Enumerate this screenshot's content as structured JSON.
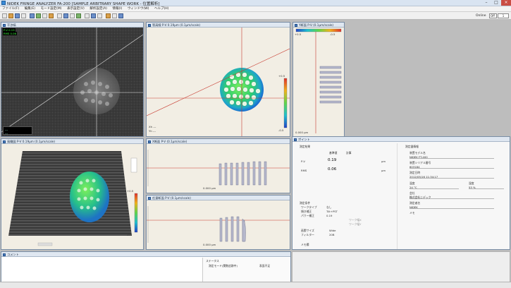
{
  "window": {
    "title": "NIDEK FRINGE ANALYZER FA-200  [SAMPLE ARBITRARY SHAPE WORK - 位置解析]"
  },
  "menu": {
    "items": [
      "ファイル(F)",
      "編集(E)",
      "モード設定(M)",
      "表示設定(V)",
      "解析設定(A)",
      "情報(I)",
      "ウィンドウ(W)",
      "ヘルプ(H)"
    ]
  },
  "toolbar": {
    "display_label": "Online",
    "display_select": "Off",
    "display_num": "1"
  },
  "panels": {
    "p1": {
      "title": "干渉縞",
      "badge_a": "P-V 0.19",
      "badge_b": "RMS 0.06",
      "legend_a": "---",
      "legend_b": "---"
    },
    "p2": {
      "title": "等高線 P-V 0.19µm (0.1µm/scale)",
      "scale_top": "+0.5",
      "scale_bottom": "-0.5",
      "legend_a": "Xh ---",
      "legend_b": "Yh ---"
    },
    "p3": {
      "title": "Y断面 P-V (0.1µm/scale)",
      "scale_top": "+0.5",
      "scale_bottom": "-0.5",
      "footer": "0.000 µm"
    },
    "p4": {
      "title": "鳥瞰図 P-V 0.19µm (0.1µm/scale)",
      "scale_top": "+0.5",
      "scale_bottom": "-0.5"
    },
    "p5": {
      "title": "X断面 P-V (0.1µm/scale)",
      "footer": "0.000 µm"
    },
    "p6": {
      "title": "任意断面 P-V (0.1µm/scale)",
      "footer": "0.000 µm"
    }
  },
  "info": {
    "title": "ポイント",
    "section_result": "測定結果",
    "col_a": "基準値",
    "col_b": "計算",
    "pv_label": "P-V",
    "pv_value": "0.19",
    "pv_unit": "µm",
    "rms_label": "RMS",
    "rms_value": "0.06",
    "rms_unit": "µm",
    "section_cond": "測定条件",
    "cond_rows": [
      {
        "label": "ワークタイプ",
        "value": "なし"
      },
      {
        "label": "傾き補正",
        "value": "Tilt+PST"
      },
      {
        "label": "パワー補正",
        "value": "0.19"
      }
    ],
    "cond_side_a": "ワーク幅X",
    "cond_side_b": "ワーク幅Y",
    "section_mask": "画素サイズ",
    "mask_value": "Wide",
    "filter_label": "フィルター",
    "filter_value": "20B",
    "section_note": "メモ欄",
    "right_title": "測定器情報",
    "model_label": "装置モデル名",
    "model_value": "NIDEK FT-400",
    "serial_label": "装置シリアル番号",
    "serial_value": "603184",
    "date_label": "測定日時",
    "date_value": "2012/05/16 11:34:17",
    "temp_label": "温度",
    "temp_value": "24 °C",
    "hum_label": "湿度",
    "hum_value": "53 %",
    "company_label": "会社",
    "company_value": "株式会社ニデック",
    "operator_label": "測定者名",
    "operator_value": "NIDEK",
    "note_label": "メモ"
  },
  "comment": {
    "title": "コメント"
  },
  "status": {
    "title": "ステータス",
    "left": "測定モード(関数追跡中)",
    "right": "表面不足"
  }
}
